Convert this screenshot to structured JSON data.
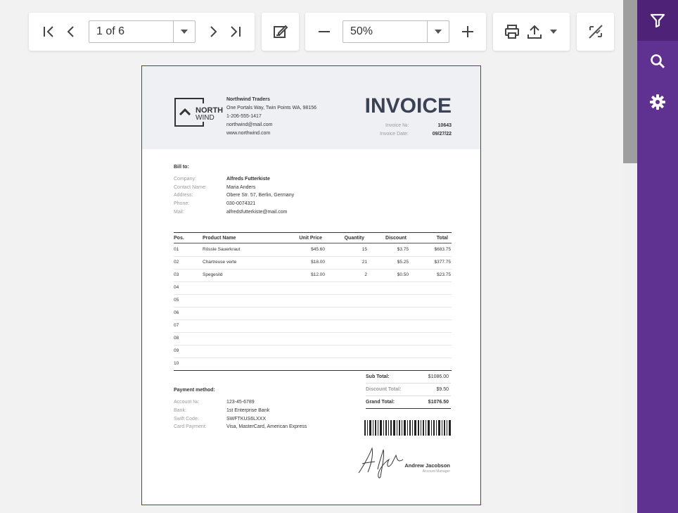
{
  "toolbar": {
    "page_value": "1 of 6",
    "zoom_value": "50%"
  },
  "invoice": {
    "logo_north": "NORTH",
    "logo_wind": "WIND",
    "company_name": "Northwind Traders",
    "company_address": "One Portals Way, Twin Points WA, 98156",
    "company_phone": "1-206-555-1417",
    "company_email": "northwind@mail.com",
    "company_web": "www.northwind.com",
    "title": "INVOICE",
    "invoice_no_label": "Invoice №:",
    "invoice_no": "10643",
    "invoice_date_label": "Invoice Date:",
    "invoice_date": "09/27/22",
    "bill_to": "Bill to:",
    "bill": {
      "company_label": "Company:",
      "company": "Alfreds Futterkiste",
      "contact_label": "Contact Name:",
      "contact": "Maria Anders",
      "address_label": "Address:",
      "address": "Obere Str. 57, Berlin, Germany",
      "phone_label": "Phone:",
      "phone": "030-0074321",
      "mail_label": "Mail:",
      "mail": "alfredsfutterkiste@mail.com"
    },
    "table": {
      "headers": {
        "pos": "Pos.",
        "name": "Product Name",
        "price": "Unit Price",
        "qty": "Quantity",
        "discount": "Discount",
        "total": "Total"
      },
      "rows": [
        {
          "pos": "01",
          "name": "Rössle Sauerkraut",
          "price": "$45.60",
          "qty": "15",
          "discount": "$3.75",
          "total": "$683.75"
        },
        {
          "pos": "02",
          "name": "Chartreuse verte",
          "price": "$18.00",
          "qty": "21",
          "discount": "$5.25",
          "total": "$377.75"
        },
        {
          "pos": "03",
          "name": "Spegesild",
          "price": "$12.00",
          "qty": "2",
          "discount": "$0.50",
          "total": "$23.75"
        },
        {
          "pos": "04",
          "name": "",
          "price": "",
          "qty": "",
          "discount": "",
          "total": ""
        },
        {
          "pos": "05",
          "name": "",
          "price": "",
          "qty": "",
          "discount": "",
          "total": ""
        },
        {
          "pos": "06",
          "name": "",
          "price": "",
          "qty": "",
          "discount": "",
          "total": ""
        },
        {
          "pos": "07",
          "name": "",
          "price": "",
          "qty": "",
          "discount": "",
          "total": ""
        },
        {
          "pos": "08",
          "name": "",
          "price": "",
          "qty": "",
          "discount": "",
          "total": ""
        },
        {
          "pos": "09",
          "name": "",
          "price": "",
          "qty": "",
          "discount": "",
          "total": ""
        },
        {
          "pos": "10",
          "name": "",
          "price": "",
          "qty": "",
          "discount": "",
          "total": ""
        }
      ]
    },
    "totals": {
      "sub_label": "Sub Total:",
      "sub": "$1086.00",
      "discount_label": "Discount Total:",
      "discount": "$9.50",
      "grand_label": "Grand Total:",
      "grand": "$1076.50"
    },
    "payment": {
      "title": "Payment method:",
      "account_label": "Account №:",
      "account": "123-45-6789",
      "bank_label": "Bank:",
      "bank": "1st Enterprise Bank",
      "swift_label": "Swift Code:",
      "swift": "SWFTKUS6LXXX",
      "card_label": "Card Payment:",
      "card": "Visa, MasterCard, American Express"
    },
    "signer_name": "Andrew Jacobson",
    "signer_title": "Account Manager"
  },
  "colors": {
    "accent": "#5f3190",
    "accent_dark": "#4e2377",
    "header_bg": "#eef0f4"
  }
}
